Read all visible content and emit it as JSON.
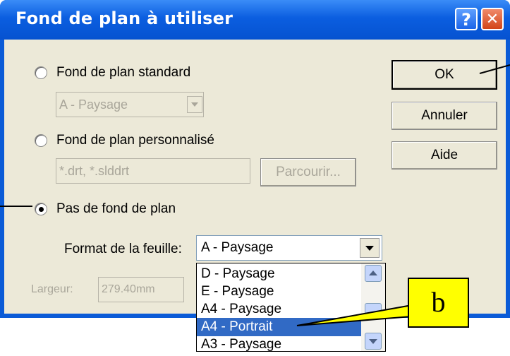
{
  "window": {
    "title": "Fond de plan à utiliser",
    "help_glyph": "?",
    "close_glyph": "✕"
  },
  "options": {
    "standard_label": "Fond de plan standard",
    "standard_value": "A - Paysage",
    "custom_label": "Fond de plan personnalisé",
    "custom_value": "*.drt, *.slddrt",
    "browse_label": "Parcourir...",
    "none_label": "Pas de fond de plan",
    "selected": "none"
  },
  "format": {
    "label": "Format de la feuille:",
    "value": "A - Paysage",
    "list_items": [
      "D - Paysage",
      "E - Paysage",
      "A4 - Paysage",
      "A4 - Portrait",
      "A3 - Paysage"
    ],
    "selected_item": "A4 - Portrait"
  },
  "width": {
    "label": "Largeur:",
    "value": "279.40mm"
  },
  "buttons": {
    "ok": "OK",
    "cancel": "Annuler",
    "help": "Aide"
  },
  "callouts": {
    "b": "b"
  },
  "colors": {
    "titlebar": "#0b5ee0",
    "dialog_bg": "#ece9d8",
    "selection": "#316ac5",
    "callout": "#ffff00"
  }
}
